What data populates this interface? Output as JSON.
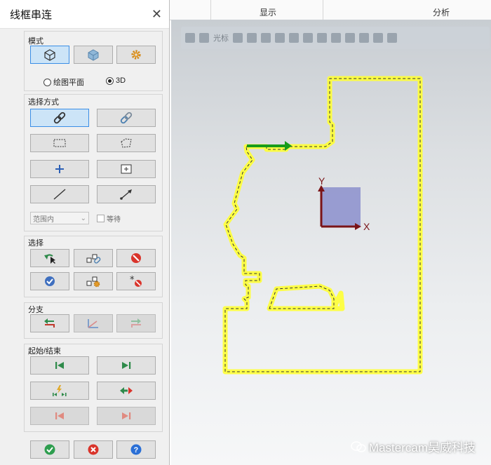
{
  "ribbon": {
    "tab_display": "显示",
    "tab_analysis": "分析"
  },
  "panel": {
    "title": "线框串连",
    "mode": {
      "label": "模式",
      "radio_plane": "绘图平面",
      "radio_3d": "3D",
      "selected": "3D"
    },
    "method": {
      "label": "选择方式",
      "scope_value": "范围内",
      "wait_label": "等待"
    },
    "select": {
      "label": "选择"
    },
    "branch": {
      "label": "分支"
    },
    "startend": {
      "label": "起始/结束"
    }
  },
  "viewport": {
    "toolbar_cursor_label": "光标",
    "axis_x": "X",
    "axis_y": "Y",
    "chain_color": "#ffff33",
    "watermark": "Mastercam昊威科技"
  },
  "colors": {
    "active_button": "#cce4f7",
    "accent": "#3a8ee6",
    "ok": "#2e9e4f",
    "cancel": "#d9342b",
    "help": "#2a6fd6"
  }
}
